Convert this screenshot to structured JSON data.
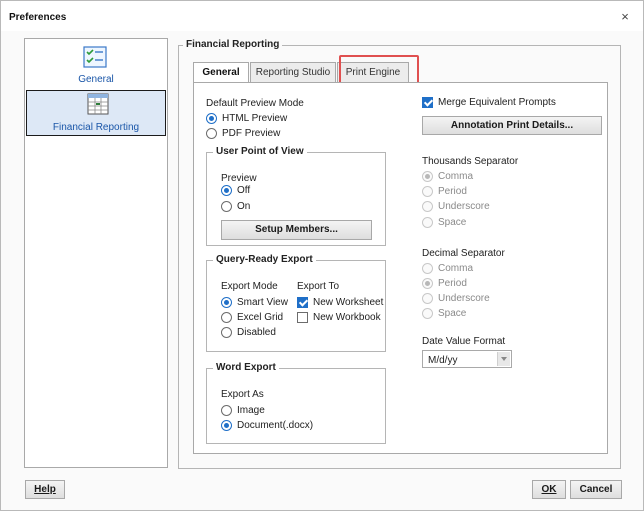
{
  "window": {
    "title": "Preferences",
    "close": "×"
  },
  "nav": {
    "items": [
      {
        "label": "General",
        "icon": "checklist-icon"
      },
      {
        "label": "Financial Reporting",
        "icon": "report-grid-icon",
        "selected": true
      }
    ]
  },
  "group": {
    "title": "Financial Reporting"
  },
  "tabs": [
    {
      "label": "General",
      "active": true
    },
    {
      "label": "Reporting Studio"
    },
    {
      "label": "Print Engine"
    }
  ],
  "preview_mode": {
    "label": "Default Preview Mode",
    "options": [
      {
        "label": "HTML Preview",
        "checked": true
      },
      {
        "label": "PDF Preview"
      }
    ]
  },
  "upov": {
    "title": "User Point of View",
    "preview_label": "Preview",
    "options": [
      {
        "label": "Off",
        "checked": true
      },
      {
        "label": "On"
      }
    ],
    "setup_button": "Setup Members..."
  },
  "query_export": {
    "title": "Query-Ready Export",
    "mode_label": "Export Mode",
    "modes": [
      {
        "label": "Smart View",
        "checked": true
      },
      {
        "label": "Excel Grid"
      },
      {
        "label": "Disabled"
      }
    ],
    "to_label": "Export To",
    "targets": [
      {
        "label": "New Worksheet",
        "checked": true
      },
      {
        "label": "New Workbook"
      }
    ]
  },
  "word_export": {
    "title": "Word Export",
    "as_label": "Export As",
    "options": [
      {
        "label": "Image"
      },
      {
        "label": "Document(.docx)",
        "checked": true
      }
    ]
  },
  "merge_prompts": {
    "label": "Merge Equivalent Prompts",
    "checked": true
  },
  "annotation_button": "Annotation Print Details...",
  "thousands": {
    "label": "Thousands Separator",
    "options": [
      {
        "label": "Comma",
        "checked": true
      },
      {
        "label": "Period"
      },
      {
        "label": "Underscore"
      },
      {
        "label": "Space"
      }
    ]
  },
  "decimal": {
    "label": "Decimal Separator",
    "options": [
      {
        "label": "Comma"
      },
      {
        "label": "Period",
        "checked": true
      },
      {
        "label": "Underscore"
      },
      {
        "label": "Space"
      }
    ]
  },
  "date_format": {
    "label": "Date Value Format",
    "value": "M/d/yy"
  },
  "footer": {
    "help": "Help",
    "ok": "OK",
    "cancel": "Cancel"
  },
  "colors": {
    "accent": "#1f6fc8",
    "highlight": "#e05050",
    "nav_selected_bg": "#dde8f6"
  }
}
